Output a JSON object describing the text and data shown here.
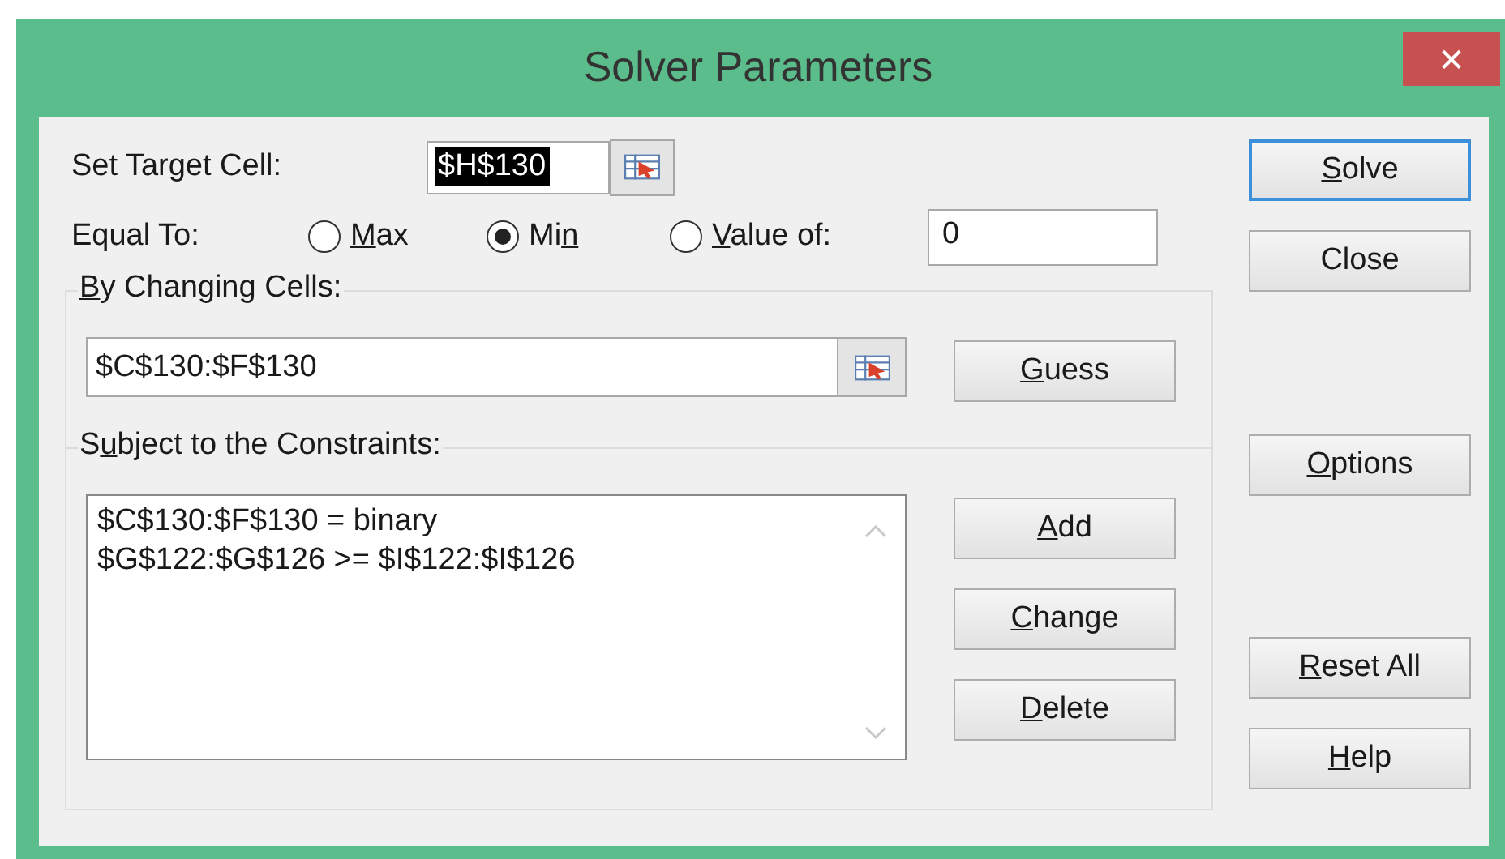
{
  "window": {
    "title": "Solver Parameters",
    "close": "✕"
  },
  "target": {
    "label": "Set Target Cell:",
    "value": "$H$130",
    "text_selected": true
  },
  "equal_to": {
    "label": "Equal To:",
    "options": [
      {
        "label": {
          "key": "M",
          "after": "ax"
        },
        "selected": false
      },
      {
        "label": {
          "before": "Mi",
          "key": "n"
        },
        "selected": true
      },
      {
        "label": {
          "key": "V",
          "after": "alue of:"
        },
        "selected": false
      }
    ],
    "value": "0"
  },
  "changing": {
    "label": {
      "key": "B",
      "after": "y Changing Cells:"
    },
    "value": "$C$130:$F$130",
    "button": {
      "label": {
        "key": "G",
        "after": "uess"
      },
      "focused": false
    }
  },
  "constraints": {
    "label": {
      "before": "S",
      "key": "u",
      "after": "bject to the Constraints:"
    },
    "items": [
      "$C$130:$F$130 = binary",
      "$G$122:$G$126 >= $I$122:$I$126"
    ],
    "buttons": [
      {
        "label": {
          "key": "A",
          "after": "dd"
        },
        "focused": false
      },
      {
        "label": {
          "key": "C",
          "after": "hange"
        },
        "focused": false
      },
      {
        "label": {
          "key": "D",
          "after": "elete"
        },
        "focused": false
      }
    ]
  },
  "side_buttons": [
    {
      "label": {
        "key": "S",
        "after": "olve"
      },
      "focused": true
    },
    {
      "label": "Close",
      "focused": false
    },
    {
      "label": {
        "key": "O",
        "after": "ptions"
      },
      "focused": false
    },
    {
      "label": {
        "key": "R",
        "after": "eset All"
      },
      "focused": false
    },
    {
      "label": {
        "key": "H",
        "after": "elp"
      },
      "focused": false
    }
  ]
}
